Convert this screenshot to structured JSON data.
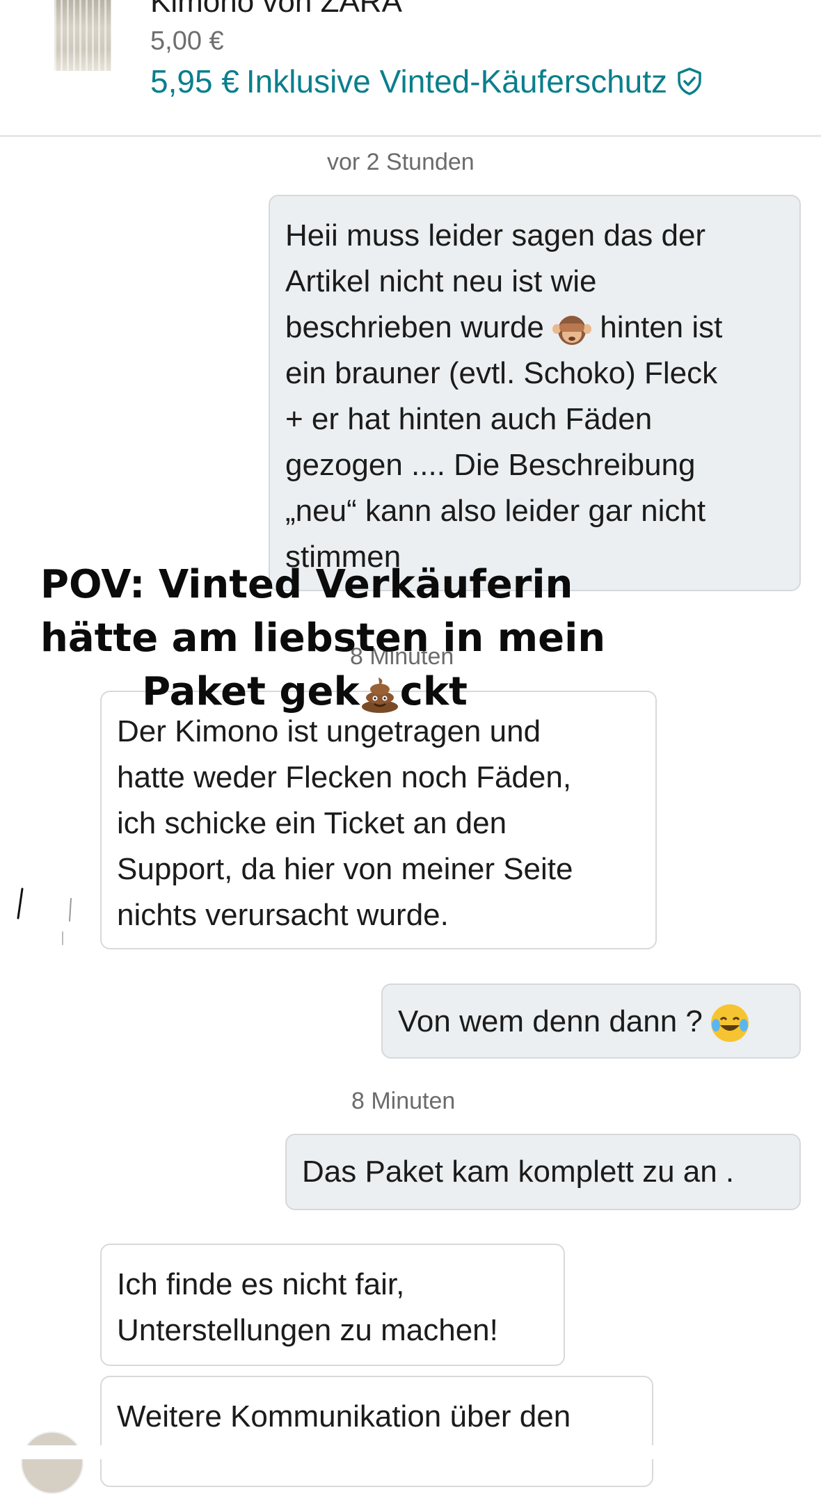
{
  "item": {
    "title": "Kimono von ZARA",
    "price": "5,00 €",
    "total": "5,95 €",
    "protection": "Inklusive Vinted-Käuferschutz"
  },
  "messages": [
    {
      "type": "time",
      "text": "vor 2 Stunden"
    },
    {
      "type": "outgoing",
      "lines": [
        "Heii muss leider sagen das der",
        "Artikel nicht neu ist wie",
        "beschrieben wurde",
        "hinten ist",
        "ein brauner (evtl. Schoko) Fleck",
        "+ er hat hinten auch Fäden",
        "gezogen .... Die Beschreibung",
        "„neu“ kann also leider gar nicht",
        "stimmen"
      ],
      "emoji": "see-no-evil-monkey"
    },
    {
      "type": "time",
      "text": "8 Minuten"
    },
    {
      "type": "incoming",
      "lines": [
        "Der Kimono ist ungetragen und",
        "hatte weder Flecken noch Fäden,",
        "ich schicke ein Ticket an den",
        "Support, da hier von meiner Seite",
        "nichts verursacht wurde."
      ]
    },
    {
      "type": "outgoing",
      "text": "Von wem denn dann ?",
      "emoji": "tears-of-joy"
    },
    {
      "type": "time",
      "text": "8 Minuten"
    },
    {
      "type": "outgoing",
      "text": "Das Paket kam komplett zu an ."
    },
    {
      "type": "incoming",
      "lines": [
        "Ich finde es nicht fair,",
        "Unterstellungen zu machen!"
      ]
    },
    {
      "type": "incoming",
      "lines": [
        "Weitere Kommunikation über den"
      ]
    }
  ],
  "overlay": {
    "line1": "POV: Vinted Verkäuferin",
    "line2": "hätte am liebsten in mein",
    "line3_a": "Paket gek",
    "line3_b": "ckt",
    "emoji": "pile-of-poo"
  },
  "colors": {
    "accent": "#0a7f8c",
    "outgoing_bubble": "#eceff1",
    "incoming_bubble": "#ffffff"
  },
  "icons": [
    "shield-check-icon",
    "see-no-evil-monkey-emoji",
    "tears-of-joy-emoji",
    "pile-of-poo-emoji"
  ]
}
